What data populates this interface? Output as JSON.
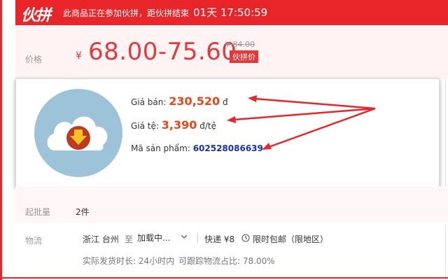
{
  "banner": {
    "logo": "伙拼",
    "text": "此商品正在参加伙拼，距伙拼结束",
    "countdown": "01天 17:50:59"
  },
  "price": {
    "label": "价格",
    "currency": "¥",
    "range": "68.00-75.60",
    "original": "¥ 84.00",
    "tag": "伙拼价"
  },
  "info": {
    "sale_label": "Giá bán:",
    "sale_value": "230,520",
    "sale_unit": "đ",
    "rate_label": "Giá tệ:",
    "rate_value": "3,390",
    "rate_unit": "đ/tệ",
    "sku_label": "Mã sản phẩm:",
    "sku_value": "602528086639",
    "icon": "cloud-download-icon",
    "accent_orange": "#e8471b",
    "accent_blue": "#1a2fb5"
  },
  "moq": {
    "label": "起批量",
    "value": "2件"
  },
  "logistics": {
    "label": "物流",
    "origin": "浙江 台州",
    "to": "至",
    "destination": "加载中...",
    "shipping": "快递 ¥8",
    "free_shipping": "限时包邮（限地区）",
    "ship_time": "实际发货时长: 24小时内",
    "tracking": "可跟踪物流占比: 78.00%"
  },
  "colors": {
    "brand_red": "#e8262a",
    "price_red": "#e4393c"
  }
}
